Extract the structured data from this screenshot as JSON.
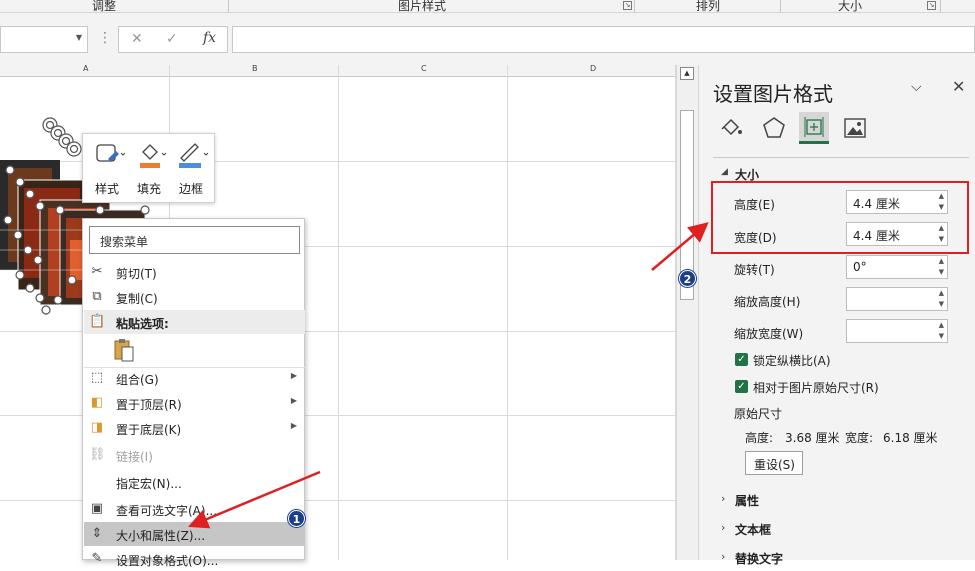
{
  "ribbon": {
    "groups": [
      "调整",
      "图片样式",
      "排列",
      "大小"
    ]
  },
  "formula_bar": {
    "cancel_glyph": "✕",
    "enter_glyph": "✓",
    "fx_glyph": "fx",
    "dots": "⋮",
    "namebox_value": "",
    "formula_value": ""
  },
  "sheet": {
    "columns": [
      "A",
      "B",
      "C",
      "D"
    ]
  },
  "mini_toolbar": {
    "style_label": "样式",
    "fill_label": "填充",
    "border_label": "边框"
  },
  "context_menu": {
    "search_placeholder": "搜索菜单",
    "items": {
      "cut": "剪切(T)",
      "copy": "复制(C)",
      "paste_options": "粘贴选项:",
      "group": "组合(G)",
      "bring_front": "置于顶层(R)",
      "send_back": "置于底层(K)",
      "link": "链接(I)",
      "assign_macro": "指定宏(N)...",
      "alt_text": "查看可选文字(A)...",
      "size_props": "大小和属性(Z)...",
      "format_object": "设置对象格式(O)..."
    }
  },
  "pane": {
    "title": "设置图片格式",
    "section_size": "大小",
    "height_label": "高度(E)",
    "height_value": "4.4 厘米",
    "width_label": "宽度(D)",
    "width_value": "4.4 厘米",
    "rotation_label": "旋转(T)",
    "rotation_value": "0°",
    "scale_h_label": "缩放高度(H)",
    "scale_h_value": "",
    "scale_w_label": "缩放宽度(W)",
    "scale_w_value": "",
    "lock_ratio_label": "锁定纵横比(A)",
    "relative_label": "相对于图片原始尺寸(R)",
    "original_size_label": "原始尺寸",
    "orig_h_label": "高度:",
    "orig_h_value": "3.68 厘米",
    "orig_w_label": "宽度:",
    "orig_w_value": "6.18 厘米",
    "reset_label": "重设(S)",
    "section_props": "属性",
    "section_textbox": "文本框",
    "section_alt": "替换文字"
  },
  "annotations": {
    "badge1": "1",
    "badge2": "2",
    "arrow_color": "#e02020",
    "highlight_color": "#e02020"
  }
}
